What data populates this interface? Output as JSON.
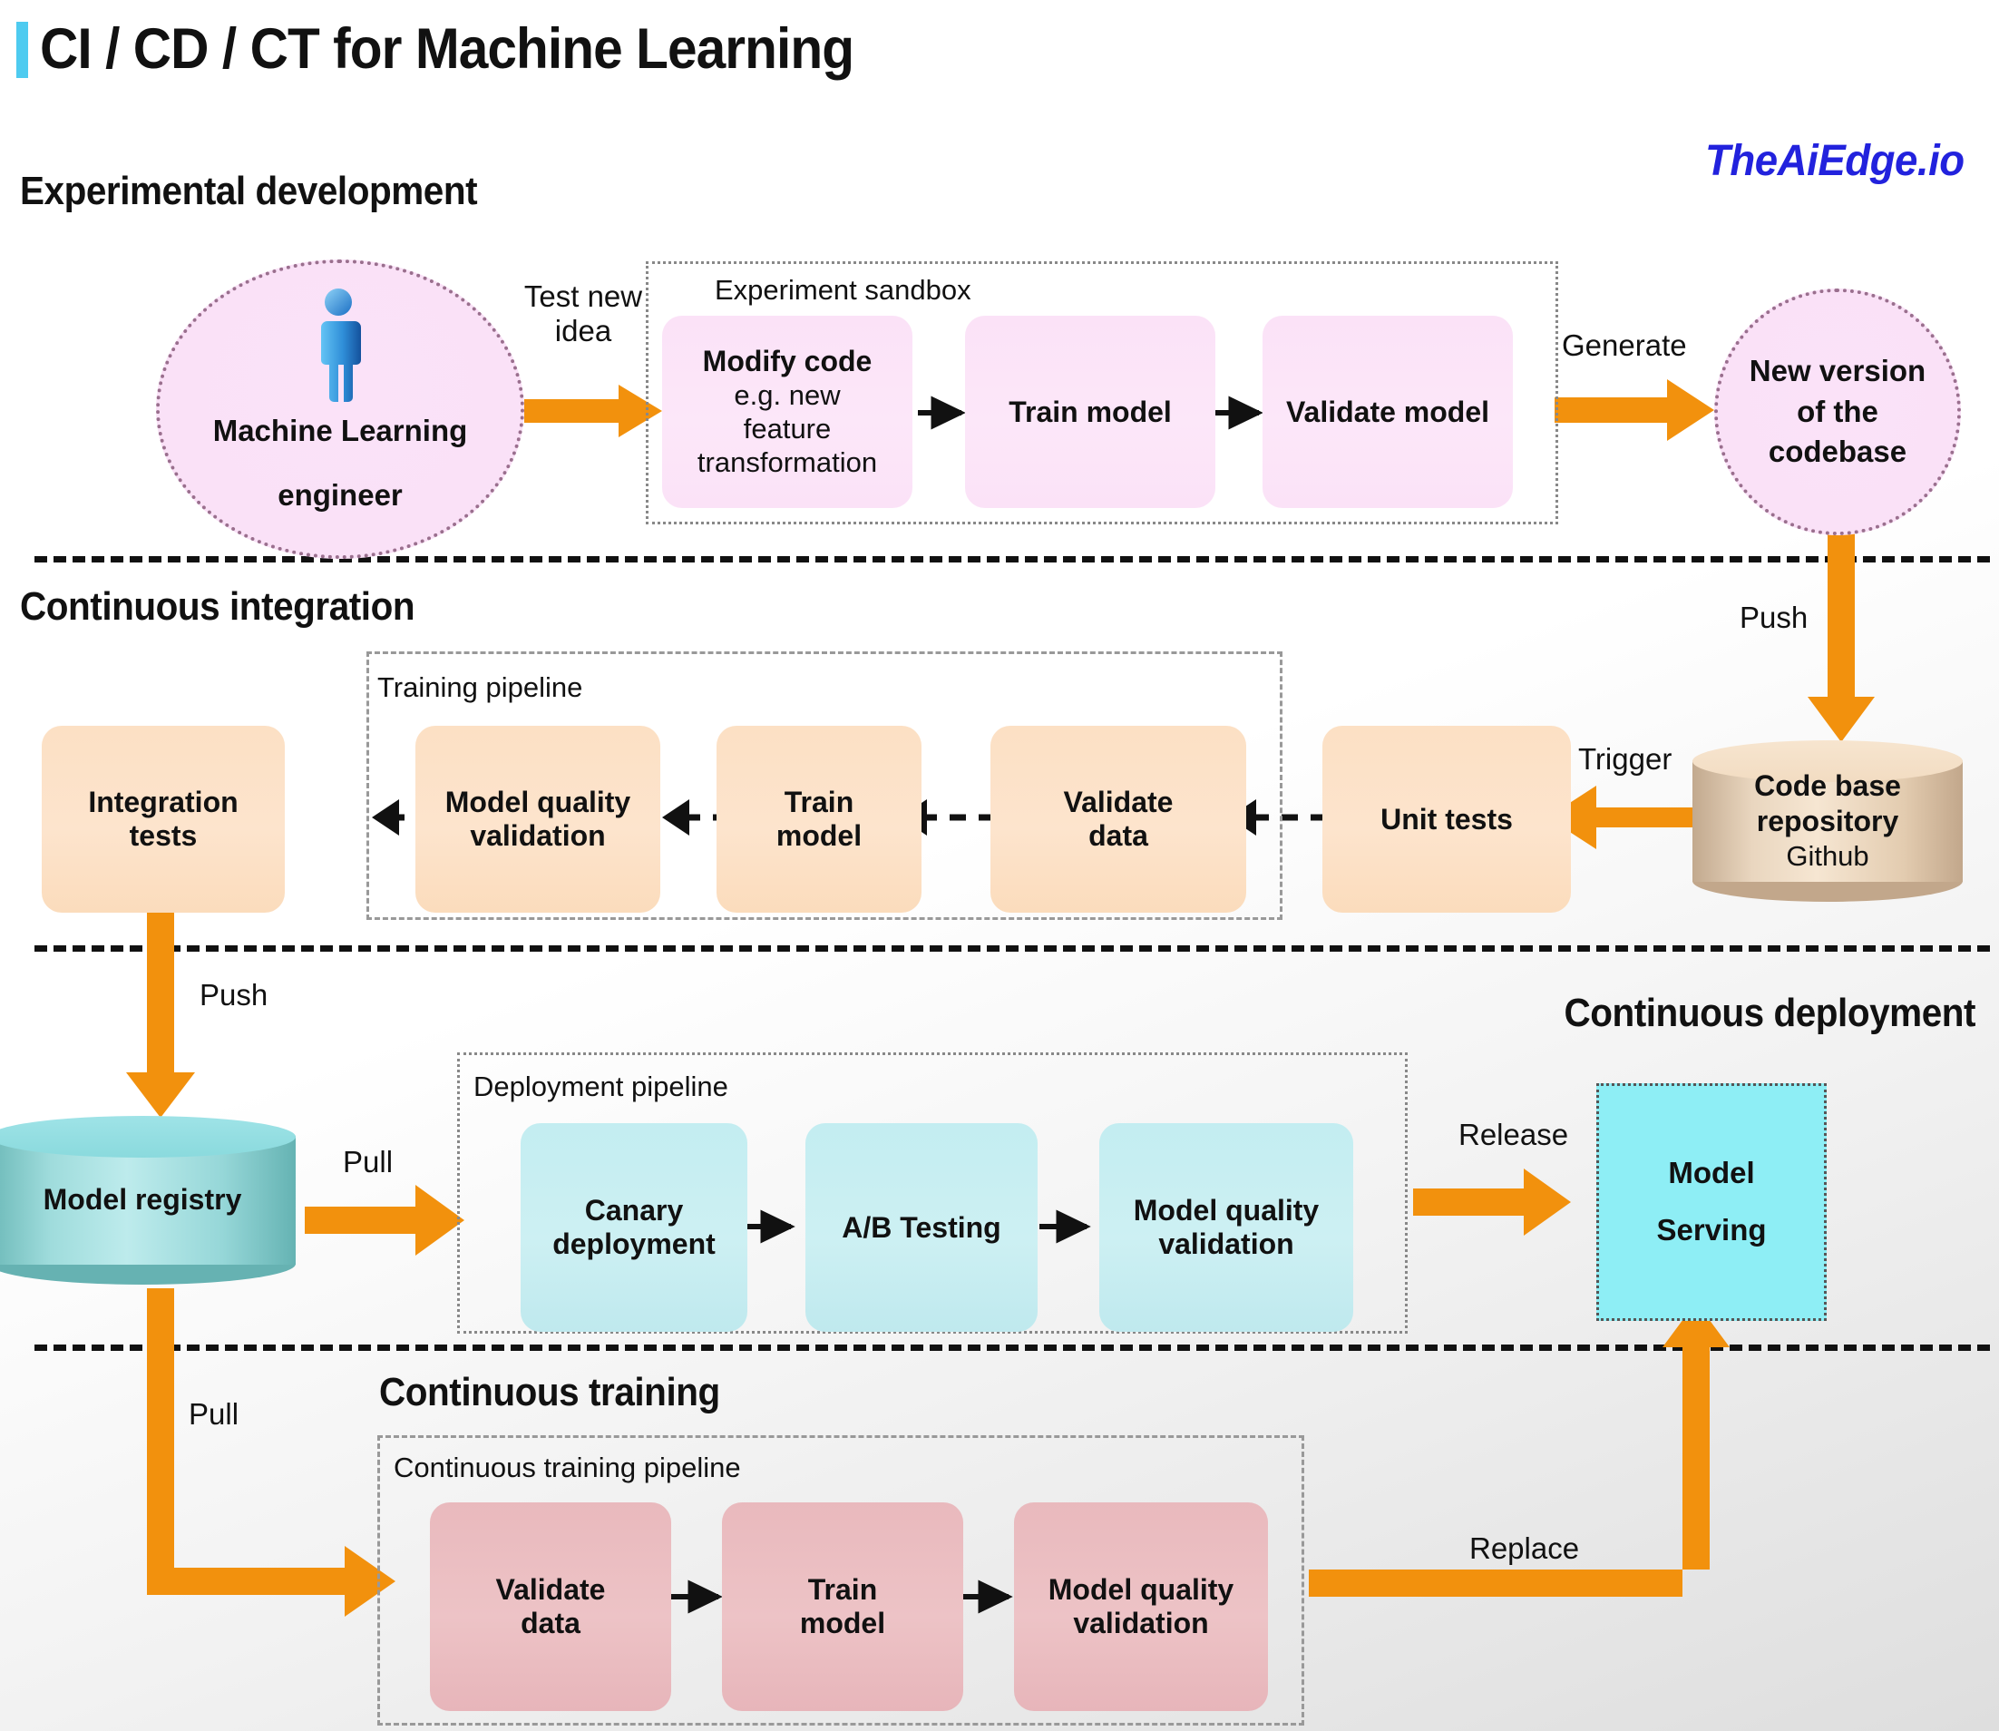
{
  "title": "CI / CD / CT for Machine Learning",
  "logo": "TheAiEdge.io",
  "accent_colors": {
    "title_bar": "#4ecbf0",
    "logo": "#2222dd",
    "arrow_orange": "#F2910D",
    "pink": "#fbe2f7",
    "peach": "#fce0c4",
    "cyan": "#c3edf1",
    "rose": "#e9b9bd",
    "serving_cyan": "#8eeef5"
  },
  "sections": {
    "experimental": {
      "heading": "Experimental development"
    },
    "ci": {
      "heading": "Continuous integration"
    },
    "cd": {
      "heading": "Continuous deployment"
    },
    "ct": {
      "heading": "Continuous training"
    }
  },
  "experimental": {
    "actor": {
      "line1": "Machine Learning",
      "line2": "engineer"
    },
    "sandbox_label": "Experiment sandbox",
    "steps": [
      {
        "title": "Modify code",
        "sub1": "e.g. new",
        "sub2": "feature",
        "sub3": "transformation"
      },
      {
        "title": "Train model"
      },
      {
        "title": "Validate model"
      }
    ],
    "arrow_test_new_idea": "Test new\nidea",
    "arrow_test_line1": "Test new",
    "arrow_test_line2": "idea",
    "arrow_generate": "Generate",
    "output": {
      "line1": "New version",
      "line2": "of the",
      "line3": "codebase"
    }
  },
  "ci": {
    "pipeline_label": "Training pipeline",
    "steps": [
      {
        "label1": "Integration",
        "label2": "tests"
      },
      {
        "label1": "Model quality",
        "label2": "validation"
      },
      {
        "label1": "Train",
        "label2": "model"
      },
      {
        "label1": "Validate",
        "label2": "data"
      },
      {
        "label1": "Unit tests",
        "label2": ""
      }
    ],
    "repository": {
      "line1": "Code base",
      "line2": "repository",
      "sub": "Github"
    },
    "arrow_push": "Push",
    "arrow_trigger": "Trigger"
  },
  "cd": {
    "registry": "Model registry",
    "pipeline_label": "Deployment pipeline",
    "steps": [
      {
        "label1": "Canary",
        "label2": "deployment"
      },
      {
        "label1": "A/B Testing",
        "label2": ""
      },
      {
        "label1": "Model quality",
        "label2": "validation"
      }
    ],
    "serving": {
      "line1": "Model",
      "line2": "Serving"
    },
    "arrow_push": "Push",
    "arrow_pull": "Pull",
    "arrow_release": "Release"
  },
  "ct": {
    "pipeline_label": "Continuous training pipeline",
    "steps": [
      {
        "label1": "Validate",
        "label2": "data"
      },
      {
        "label1": "Train",
        "label2": "model"
      },
      {
        "label1": "Model quality",
        "label2": "validation"
      }
    ],
    "arrow_pull": "Pull",
    "arrow_replace": "Replace"
  }
}
